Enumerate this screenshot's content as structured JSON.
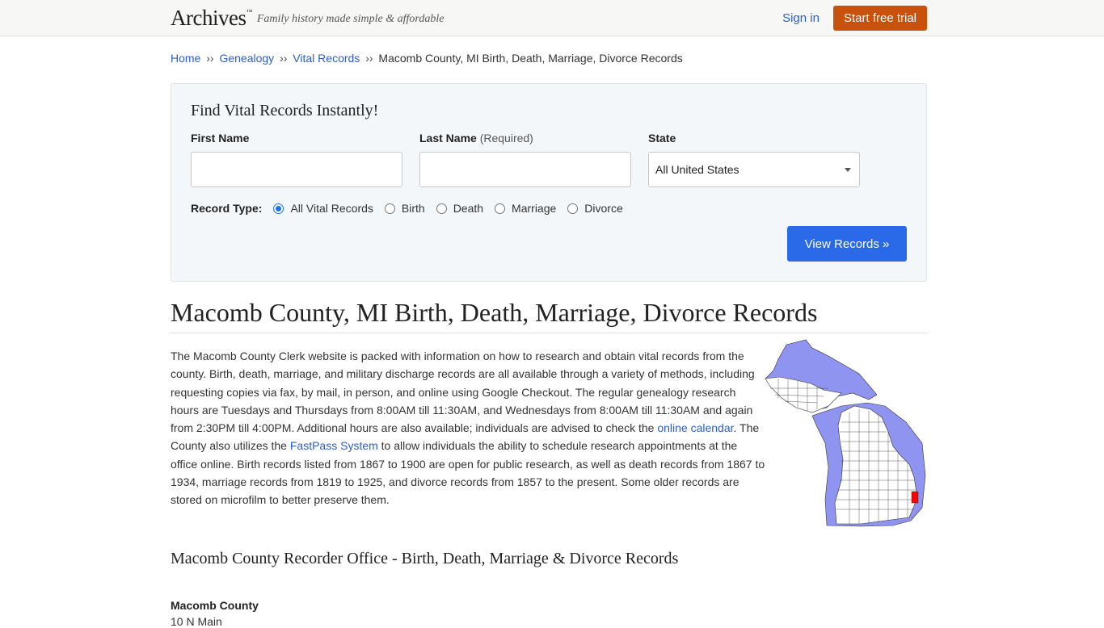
{
  "header": {
    "logo": "Archives",
    "logo_mark": "™",
    "tagline": "Family history made simple & affordable",
    "signin": "Sign in",
    "trial": "Start free trial"
  },
  "breadcrumb": {
    "items": [
      "Home",
      "Genealogy",
      "Vital Records"
    ],
    "separator": "››",
    "current": "Macomb County, MI Birth, Death, Marriage, Divorce Records"
  },
  "search": {
    "title": "Find Vital Records Instantly!",
    "first_name_label": "First Name",
    "last_name_label": "Last Name",
    "last_name_req": "(Required)",
    "state_label": "State",
    "state_value": "All United States",
    "record_type_label": "Record Type:",
    "record_types": [
      "All Vital Records",
      "Birth",
      "Death",
      "Marriage",
      "Divorce"
    ],
    "selected_record_type": "All Vital Records",
    "submit": "View Records »"
  },
  "page": {
    "title": "Macomb County, MI Birth, Death, Marriage, Divorce Records",
    "para_1": "The Macomb County Clerk website is packed with information on how to research and obtain vital records from the county. Birth, death, marriage, and military discharge records are all available through a variety of methods, including requesting copies via fax, by mail, in person, and online using Google Checkout. The regular genealogy research hours are Tuesdays and Thursdays from 8:00AM till 11:30AM, and Wednesdays from 8:00AM till 11:30AM and again from 2:30PM till 4:00PM. Additional hours are also available; individuals are advised to check the ",
    "link_1": "online calendar",
    "para_2": ". The County also utilizes the ",
    "link_2": "FastPass System",
    "para_3": " to allow individuals the ability to schedule research appointments at the office online. Birth records listed from 1867 to 1900 are open for public research, as well as death records from 1867 to 1934, marriage records from 1819 to 1925, and divorce records from 1857 to the present. Some older records are stored on microfilm to better preserve them.",
    "sub_title": "Macomb County Recorder Office - Birth, Death, Marriage & Divorce Records",
    "office_name": "Macomb County",
    "office_address_1": "10 N Main"
  },
  "colors": {
    "link": "#2c5fc4",
    "trial_button": "#c8510b",
    "view_button": "#2a6ae9",
    "map_water": "#8f94f0",
    "map_highlight": "#ff0000"
  }
}
